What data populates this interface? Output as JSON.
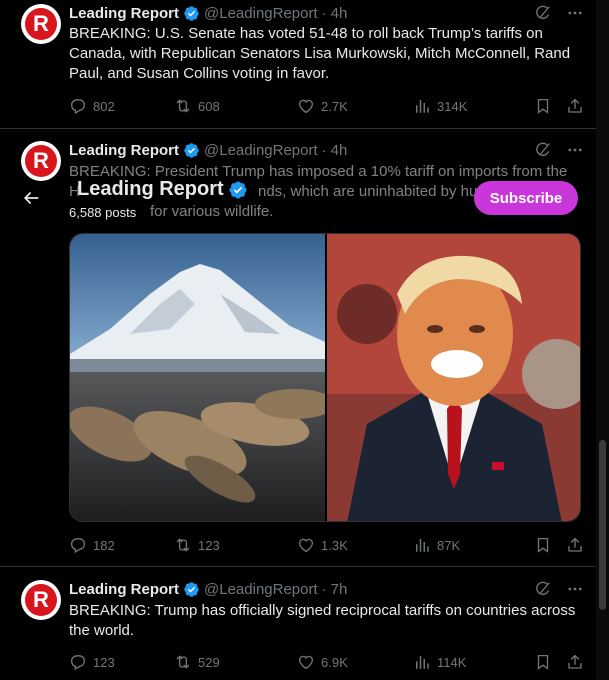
{
  "colors": {
    "background": "#000000",
    "text": "#e7e9ea",
    "muted": "#71767b",
    "verified": "#1d9bf0",
    "subscribe": "#c936d9",
    "brand_red": "#d8141c"
  },
  "header_overlay": {
    "name": "Leading Report",
    "posts": "6,588 posts",
    "subscribe_label": "Subscribe"
  },
  "tweets": [
    {
      "name": "Leading Report",
      "handle": "@LeadingReport",
      "dot": "·",
      "time": "4h",
      "text": "BREAKING: U.S. Senate has voted 51-48 to roll back Trump’s tariffs on Canada, with Republican Senators Lisa Murkowski, Mitch McConnell, Rand Paul, and Susan Collins voting in favor.",
      "replies": "802",
      "retweets": "608",
      "likes": "2.7K",
      "views": "314K"
    },
    {
      "name": "Leading Report",
      "handle": "@LeadingReport",
      "dot": "·",
      "time": "4h",
      "text_line1": "BREAKING: President Trump has imposed a 10% tariff on imports from the",
      "text_line2_start": "H",
      "text_line2_end": "nds, which are uninhabited by hum",
      "text_line3": "for various wildlife.",
      "replies": "182",
      "retweets": "123",
      "likes": "1.3K",
      "views": "87K"
    },
    {
      "name": "Leading Report",
      "handle": "@LeadingReport",
      "dot": "·",
      "time": "7h",
      "text": "BREAKING: Trump has officially signed reciprocal tariffs on countries across the world.",
      "replies": "123",
      "retweets": "529",
      "likes": "6.9K",
      "views": "114K"
    }
  ],
  "avatar_letter": "R",
  "icons": {
    "verified": "verified-badge-icon",
    "grok": "grok-icon",
    "more": "more-icon",
    "reply": "reply-icon",
    "retweet": "retweet-icon",
    "like": "heart-icon",
    "views": "views-icon",
    "bookmark": "bookmark-icon",
    "share": "share-icon",
    "back": "back-arrow-icon"
  }
}
